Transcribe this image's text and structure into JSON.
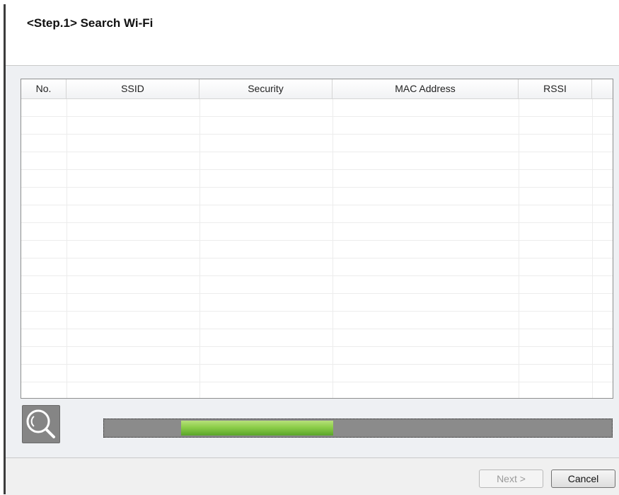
{
  "header": {
    "title": "<Step.1>  Search Wi-Fi"
  },
  "table": {
    "columns": [
      "No.",
      "SSID",
      "Security",
      "MAC Address",
      "RSSI"
    ],
    "rows": []
  },
  "scan": {
    "progress_range": [
      0.15,
      0.45
    ]
  },
  "footer": {
    "next_label": "Next >",
    "cancel_label": "Cancel"
  },
  "icons": {
    "search": "magnifier-icon"
  },
  "colors": {
    "progress_fill": "#8ccd49",
    "progress_track": "#8b8b8b"
  }
}
